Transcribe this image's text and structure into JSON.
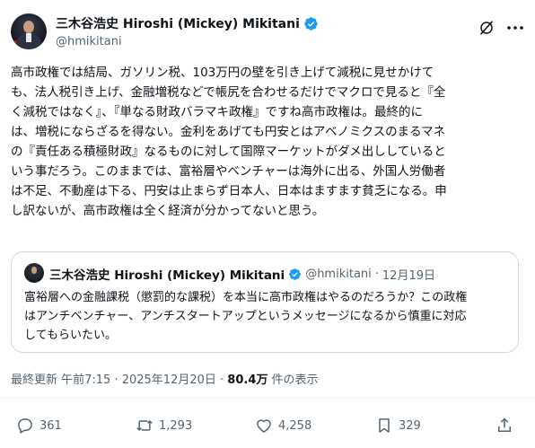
{
  "author": {
    "display_name": "三木谷浩史 Hiroshi (Mickey) Mikitani",
    "handle": "@hmikitani"
  },
  "header_icons": [
    "grok-icon",
    "more-icon"
  ],
  "tweet": {
    "text": "高市政権では結局、ガソリン税、103万円の壁を引き上げて減税に見せかけて\nも、法人税引き上げ、金融増税などで帳尻を合わせるだけでマクロで見ると『全\nく減税ではなく』、『単なる財政バラマキ政権』ですね高市政権は。最終的に\nは、増税にならざるを得ない。金利をあげても円安とはアベノミクスのまるマネ\nの『責任ある積極財政』なるものに対して国際マーケットがダメ出ししていると\nいう事だろう。このままでは、富裕層やベンチャーは海外に出る、外国人労働者\nは不足、不動産は下る、円安は止まらず日本人、日本はますます貧乏になる。申\nし訳ないが、高市政権は全く経済が分かってないと思う。"
  },
  "quoted_tweet": {
    "display_name": "三木谷浩史 Hiroshi (Mickey) Mikitani",
    "handle": "@hmikitani",
    "separator": "·",
    "date": "12月19日",
    "text": "富裕層への金融課税（懲罰的な課税）を本当に高市政権はやるのだろうか？この政権\nはアンチベンチャー、アンチスタートアップというメッセージになるから慎重に対応\nしてもらいたい。"
  },
  "meta": {
    "last_edited_prefix": "最終更新 午前7:15 · 2025年12月20日 · ",
    "views_count": "80.4万",
    "views_suffix": " 件の表示"
  },
  "actions": {
    "replies": "361",
    "reposts": "1,293",
    "likes": "4,258",
    "bookmarks": "329"
  },
  "colors": {
    "verified": "#1d9bf0",
    "secondary_text": "#536471",
    "border": "#cfd9de"
  }
}
